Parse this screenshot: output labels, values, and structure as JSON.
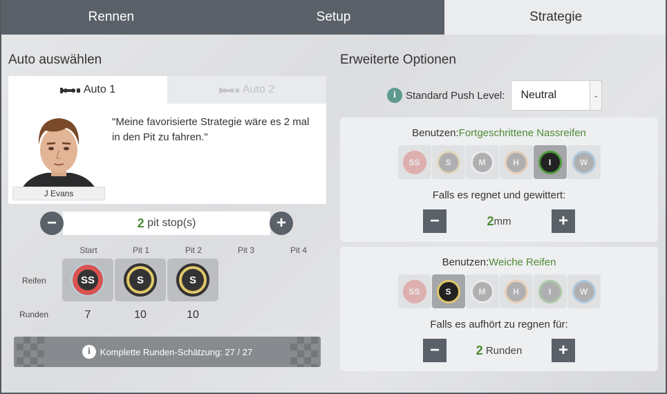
{
  "tabs": [
    {
      "label": "Rennen",
      "active": false
    },
    {
      "label": "Setup",
      "active": false
    },
    {
      "label": "Strategie",
      "active": true
    }
  ],
  "left": {
    "title": "Auto auswählen",
    "car_tabs": [
      {
        "label": "Auto 1",
        "active": true
      },
      {
        "label": "Auto 2",
        "active": false
      }
    ],
    "driver_name": "J Evans",
    "quote": "\"Meine favorisierte Strategie wäre es 2 mal in den Pit zu fahren.\"",
    "pit_stops": {
      "count": "2",
      "label": "pit stop(s)",
      "minus": "−",
      "plus": "+"
    },
    "pit_headers": [
      "Start",
      "Pit 1",
      "Pit 2",
      "Pit 3",
      "Pit 4"
    ],
    "row_tires_label": "Reifen",
    "row_laps_label": "Runden",
    "stints": [
      {
        "tire": "SS",
        "laps": "7"
      },
      {
        "tire": "S",
        "laps": "10"
      },
      {
        "tire": "S",
        "laps": "10"
      }
    ],
    "estimate": "Komplette Runden-Schätzung: 27 / 27",
    "info_icon": "i"
  },
  "right": {
    "title": "Erweiterte Optionen",
    "push_label": "Standard Push Level:",
    "push_value": "Neutral",
    "info_icon": "i",
    "tire_letters": [
      "SS",
      "S",
      "M",
      "H",
      "I",
      "W"
    ],
    "wet": {
      "use_label": "Benutzen:",
      "use_value": "Fortgeschrittene Nassreifen",
      "selected": "I",
      "condition": "Falls es regnet und gewittert:",
      "value": "2",
      "unit": "mm"
    },
    "dry": {
      "use_label": "Benutzen:",
      "use_value": "Weiche Reifen",
      "selected": "S",
      "condition": "Falls es aufhört zu regnen für:",
      "value": "2",
      "unit": "Runden"
    },
    "minus": "−",
    "plus": "+"
  },
  "colors": {
    "SS": "#d9534f",
    "S": "#e2c86a",
    "M": "#ffffff",
    "H": "#f2b26b",
    "I": "#4e9a3a",
    "W": "#5d9fd6",
    "tab_bg": "#5b6168",
    "accent_green": "#4d8a35"
  }
}
